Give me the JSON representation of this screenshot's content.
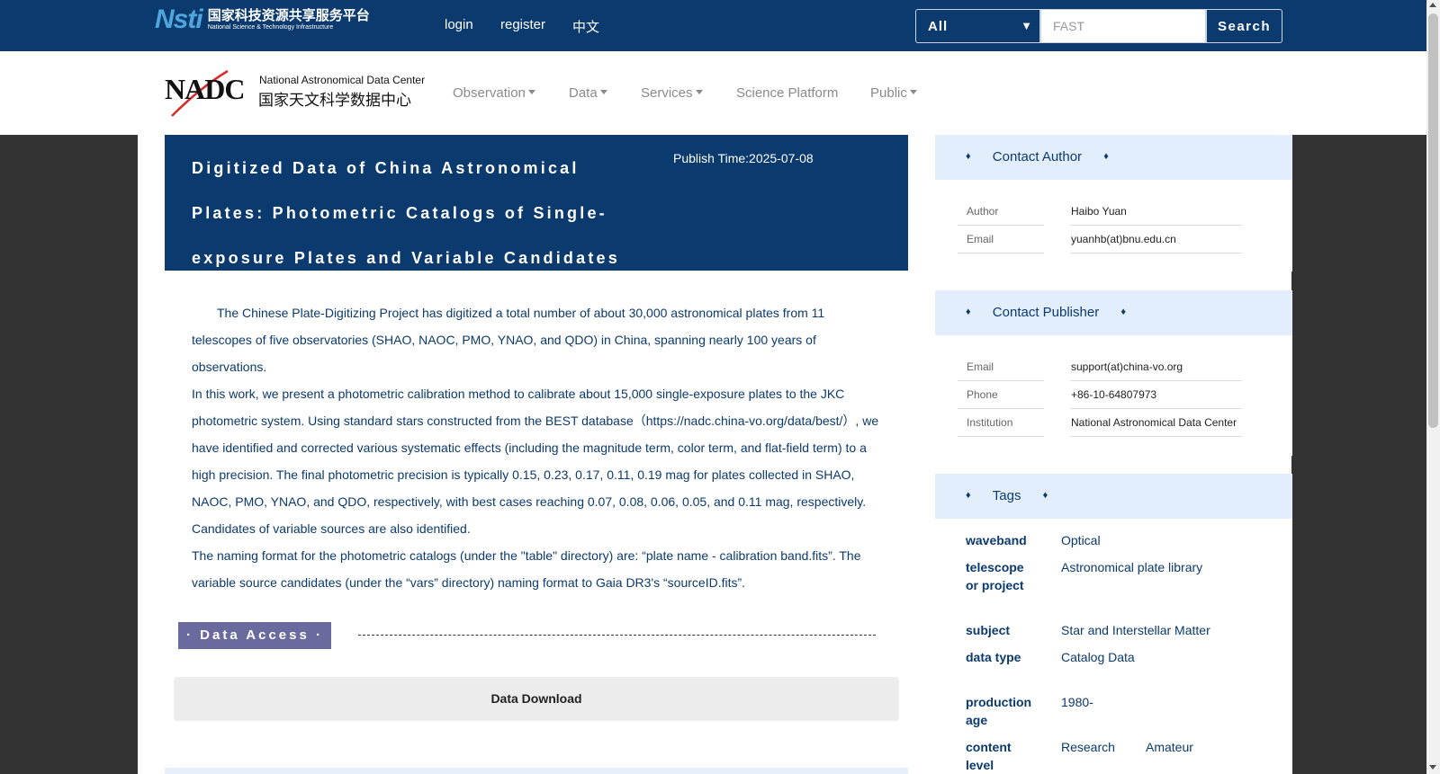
{
  "topbar": {
    "logo_mark": "Nsti",
    "logo_cn": "国家科技资源共享服务平台",
    "logo_en": "National Science & Technology Infrastructure",
    "links": [
      "login",
      "register",
      "中文"
    ],
    "search_scope": "All",
    "search_value": "FAST",
    "search_button": "Search"
  },
  "navbar": {
    "logo_big": "NADC",
    "logo_en": "National Astronomical Data Center",
    "logo_cn": "国家天文科学数据中心",
    "items": [
      {
        "label": "Observation"
      },
      {
        "label": "Data"
      },
      {
        "label": "Services"
      },
      {
        "label": "Science Platform"
      },
      {
        "label": "Public"
      }
    ]
  },
  "article": {
    "title": "Digitized Data of China Astronomical Plates: Photometric Catalogs of Single-exposure Plates and Variable Candidates",
    "publish_time": "Publish Time:2025-07-08",
    "paragraphs": [
      "The Chinese Plate-Digitizing Project has digitized a total number of about 30,000  astronomical plates from 11 telescopes of five observatories (SHAO, NAOC, PMO, YNAO, and QDO) in China, spanning nearly 100 years of observations.",
      "In this work, we present a photometric calibration method to calibrate about 15,000 single-exposure plates to the JKC photometric system. Using standard stars constructed from the BEST database（https://nadc.china-vo.org/data/best/）, we have identified and corrected various systematic effects (including the magnitude term, color term, and flat-field term) to a high precision. The final photometric precision is typically 0.15, 0.23, 0.17, 0.11, 0.19 mag for plates collected in SHAO, NAOC, PMO, YNAO, and QDO, respectively, with best cases reaching 0.07, 0.08, 0.06, 0.05, and 0.11 mag, respectively. Candidates of variable sources are also identified.",
      "The naming format for the photometric catalogs (under the \"table\" directory) are: “plate name - calibration band.fits”. The variable source candidates (under the “vars” directory) naming format to Gaia DR3's “sourceID.fits”."
    ],
    "data_access_label": "· Data Access ·",
    "download_label": "Data Download"
  },
  "sidebar": {
    "diamond": "♦",
    "contact_author": {
      "title": "Contact Author",
      "rows": [
        {
          "key": "Author",
          "value": "Haibo Yuan"
        },
        {
          "key": "Email",
          "value": "yuanhb(at)bnu.edu.cn"
        }
      ]
    },
    "contact_publisher": {
      "title": "Contact Publisher",
      "rows": [
        {
          "key": "Email",
          "value": "support(at)china-vo.org"
        },
        {
          "key": "Phone",
          "value": "+86-10-64807973"
        },
        {
          "key": "Institution",
          "value": "National Astronomical Data Center"
        }
      ]
    },
    "tags": {
      "title": "Tags",
      "waveband_key": "waveband",
      "waveband": "Optical",
      "telescope_key": "telescope or project",
      "telescope": "Astronomical plate library",
      "subject_key": "subject",
      "subject": "Star and Interstellar Matter",
      "datatype_key": "data type",
      "datatype": "Catalog Data",
      "production_key": "production age",
      "production": "1980-",
      "content_key": "content level",
      "content": [
        "Research",
        "Amateur"
      ]
    }
  },
  "colors": {
    "primary": "#0b3a6e",
    "panel_head": "#e2eefb",
    "badge": "#6b6a9e",
    "page_bg": "#333333"
  }
}
